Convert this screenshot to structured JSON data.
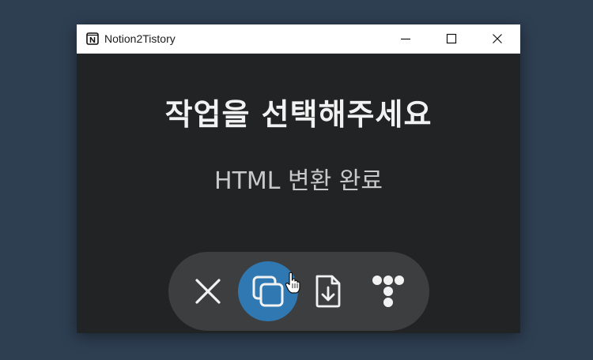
{
  "window": {
    "title": "Notion2Tistory",
    "controls": {
      "minimize": "minimize-icon",
      "maximize": "maximize-icon",
      "close": "close-icon"
    }
  },
  "main": {
    "heading": "작업을 선택해주세요",
    "status": "HTML 변환 완료"
  },
  "actions": [
    {
      "name": "cancel",
      "icon": "x-icon",
      "active": false
    },
    {
      "name": "copy",
      "icon": "copy-icon",
      "active": true
    },
    {
      "name": "download-file",
      "icon": "file-download-icon",
      "active": false
    },
    {
      "name": "tistory",
      "icon": "tistory-logo-icon",
      "active": false
    }
  ],
  "colors": {
    "desktop": "#2e3f52",
    "window_bg": "#222325",
    "action_bar": "#3d3e40",
    "active_button": "#2f78b1"
  }
}
